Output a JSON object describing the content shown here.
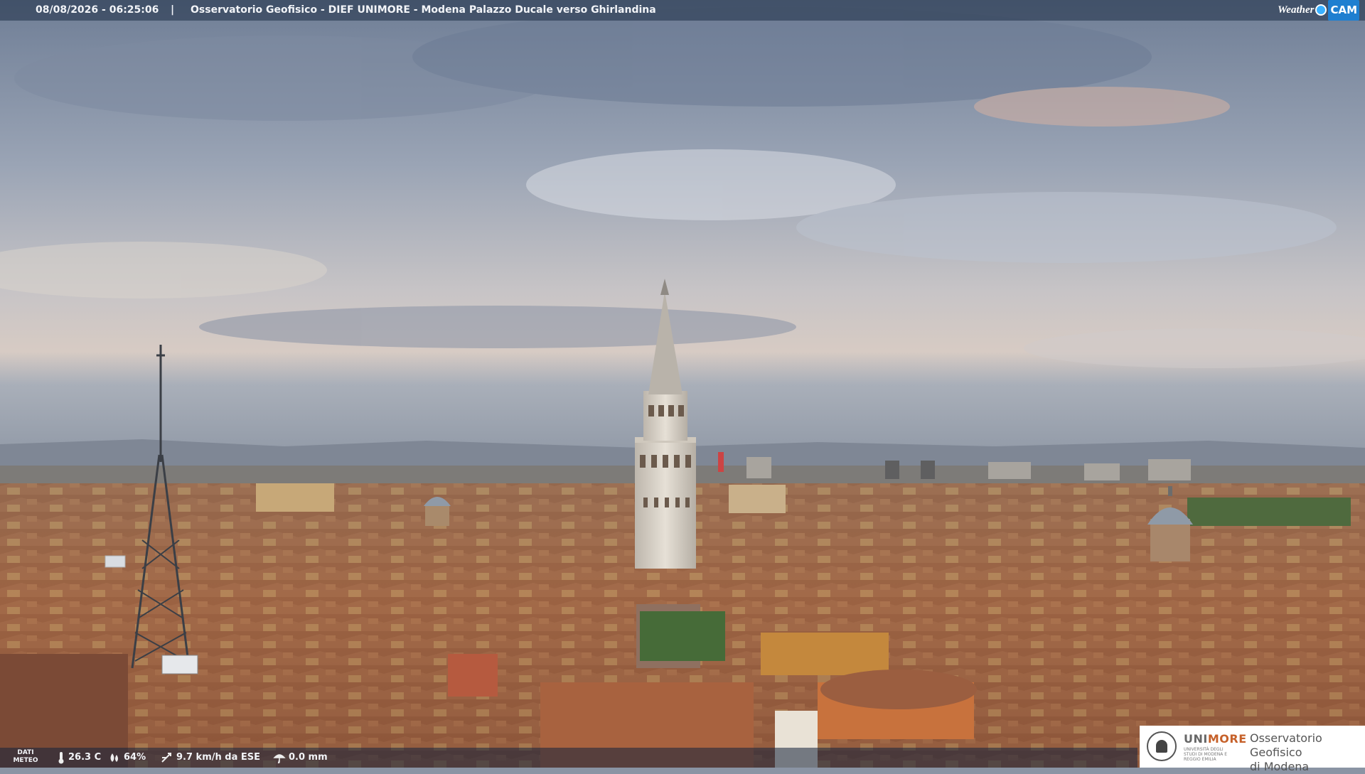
{
  "header": {
    "timestamp": "08/08/2026 - 06:25:06",
    "separator": "|",
    "title": "Osservatorio Geofisico - DIEF UNIMORE - Modena Palazzo Ducale verso Ghirlandina",
    "brand_weather": "Weather",
    "brand_cam": "CAM"
  },
  "weather": {
    "label_line1": "DATI",
    "label_line2": "METEO",
    "temperature": "26.3 C",
    "humidity": "64%",
    "wind": "9.7 km/h da ESE",
    "rain": "0.0 mm",
    "icons": [
      "thermometer-icon",
      "humidity-icon",
      "wind-icon",
      "rain-icon"
    ]
  },
  "logo": {
    "uni_part1": "UNI",
    "uni_part2": "MORE",
    "uni_sub": "UNIVERSITÀ DEGLI STUDI DI MODENA E REGGIO EMILIA",
    "obs_line1": "Osservatorio Geofisico",
    "obs_line2": "di Modena"
  },
  "colors": {
    "sky_top": "#7f8ea6",
    "sky_mid": "#b9bfca",
    "horizon": "#d8c9c0",
    "roof": "#9a5a3a",
    "facade": "#c9a06a",
    "tower": "#dcd6cc",
    "accent_orange": "#c6612a"
  }
}
